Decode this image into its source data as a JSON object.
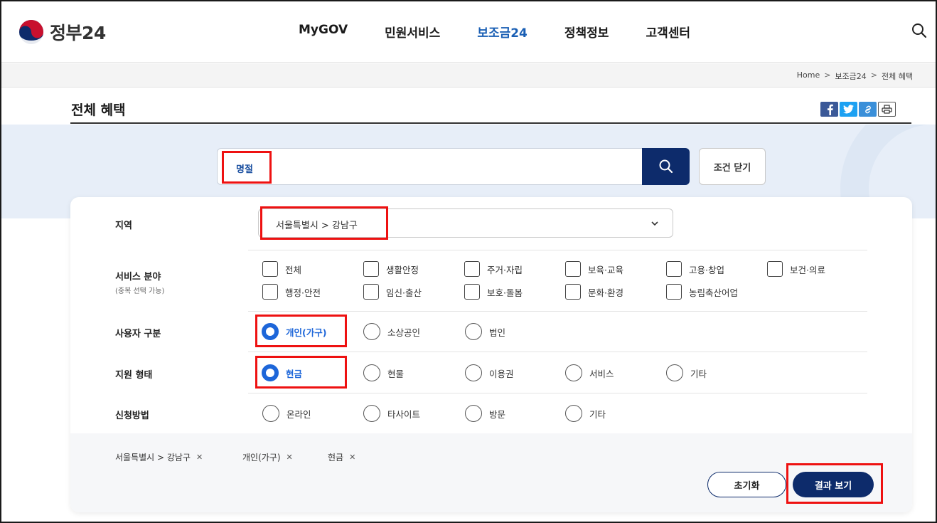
{
  "header": {
    "logo_text": "정부24",
    "nav": [
      "MyGOV",
      "민원서비스",
      "보조금24",
      "정책정보",
      "고객센터"
    ],
    "nav_active": "보조금24",
    "brand_color": "#0d2b6b",
    "accent_color": "#1d66d9",
    "search_icon": "search-icon"
  },
  "breadcrumb": [
    "Home",
    "보조금24",
    "전체 혜택"
  ],
  "page": {
    "title": "전체 혜택",
    "share_icons": [
      "facebook-icon",
      "twitter-icon",
      "link-icon",
      "print-icon"
    ]
  },
  "search": {
    "value": "명절",
    "toggle_label": "조건 닫기"
  },
  "filters": {
    "region": {
      "label": "지역",
      "selected": "서울특별시 > 강남구"
    },
    "service_field": {
      "label": "서비스 분야",
      "sublabel": "(중복 선택 가능)",
      "options": [
        "전체",
        "생활안정",
        "주거·자립",
        "보육·교육",
        "고용·창업",
        "보건·의료",
        "행정·안전",
        "임신·출산",
        "보호·돌봄",
        "문화·환경",
        "농림축산어업"
      ]
    },
    "user_type": {
      "label": "사용자 구분",
      "options": [
        "개인(가구)",
        "소상공인",
        "법인"
      ],
      "selected": "개인(가구)"
    },
    "support_type": {
      "label": "지원 형태",
      "options": [
        "현금",
        "현물",
        "이용권",
        "서비스",
        "기타"
      ],
      "selected": "현금"
    },
    "apply_method": {
      "label": "신청방법",
      "options": [
        "온라인",
        "타사이트",
        "방문",
        "기타"
      ]
    }
  },
  "selected_tags": [
    "서울특별시 > 강남구",
    "개인(가구)",
    "현금"
  ],
  "actions": {
    "reset_label": "초기화",
    "result_label": "결과 보기"
  }
}
